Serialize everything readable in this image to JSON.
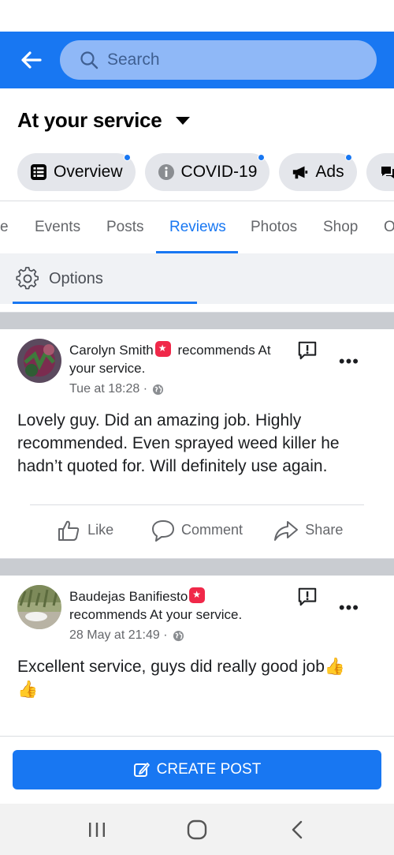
{
  "search": {
    "placeholder": "Search"
  },
  "page": {
    "title": "At your service"
  },
  "chips": [
    {
      "label": "Overview",
      "icon": "list-icon",
      "dot": true
    },
    {
      "label": "COVID-19",
      "icon": "info-icon",
      "dot": true
    },
    {
      "label": "Ads",
      "icon": "megaphone-icon",
      "dot": true
    },
    {
      "label": "",
      "icon": "messenger-icon",
      "dot": false
    }
  ],
  "tabs": [
    {
      "label": "e"
    },
    {
      "label": "Events"
    },
    {
      "label": "Posts"
    },
    {
      "label": "Reviews",
      "active": true
    },
    {
      "label": "Photos"
    },
    {
      "label": "Shop"
    },
    {
      "label": "O"
    }
  ],
  "options": {
    "label": "Options"
  },
  "reviews": [
    {
      "author": "Carolyn Smith",
      "recommends_text_1": "recommends At",
      "recommends_text_2": "your service.",
      "time": "Tue at 18:28 ·",
      "body": "Lovely guy. Did an amazing job. Highly recommended. Even sprayed weed killer he hadn’t quoted for. Will definitely use again."
    },
    {
      "author": "Baudejas Banifiesto",
      "recommends_text_1": "recommends At your service.",
      "time": "28 May at 21:49 ·",
      "body": "Excellent service, guys did really good job",
      "emoji": "👍"
    }
  ],
  "actions": {
    "like": "Like",
    "comment": "Comment",
    "share": "Share"
  },
  "create_post": {
    "label": "CREATE POST"
  },
  "colors": {
    "brand": "#1877f2",
    "badge": "#f02849"
  }
}
